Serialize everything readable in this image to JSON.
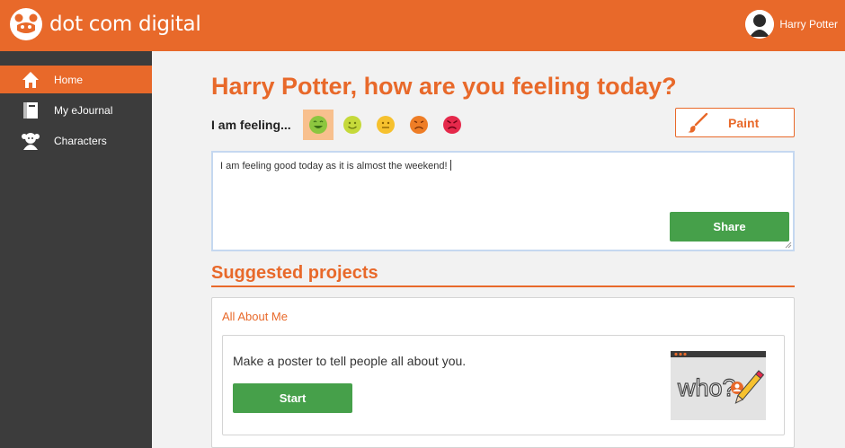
{
  "app": {
    "name": "dot com digital"
  },
  "user": {
    "name": "Harry Potter"
  },
  "sidebar": {
    "items": [
      {
        "label": "Home",
        "icon": "home-icon",
        "active": true
      },
      {
        "label": "My eJournal",
        "icon": "journal-icon",
        "active": false
      },
      {
        "label": "Characters",
        "icon": "characters-icon",
        "active": false
      }
    ]
  },
  "main": {
    "heading": "Harry Potter, how are you feeling today?",
    "feeling_label": "I am feeling...",
    "moods": [
      {
        "icon": "very-happy-face-icon",
        "color": "#8cc63f",
        "selected": true
      },
      {
        "icon": "happy-face-icon",
        "color": "#c5d93a",
        "selected": false
      },
      {
        "icon": "neutral-face-icon",
        "color": "#f6c12e",
        "selected": false
      },
      {
        "icon": "sad-face-icon",
        "color": "#ee7d26",
        "selected": false
      },
      {
        "icon": "angry-face-icon",
        "color": "#e5294b",
        "selected": false
      }
    ],
    "paint_label": "Paint",
    "entry_text": "I am feeling good today as it is almost the weekend!",
    "share_label": "Share"
  },
  "suggested": {
    "title": "Suggested projects",
    "card_title": "All About Me",
    "project_desc": "Make a poster to tell people all about you.",
    "start_label": "Start",
    "thumb_text": "who?"
  },
  "colors": {
    "brand": "#e8692a",
    "sidebar": "#3c3c3c",
    "button_green": "#46a04a",
    "mood_selected_bg": "#f8c08e"
  }
}
